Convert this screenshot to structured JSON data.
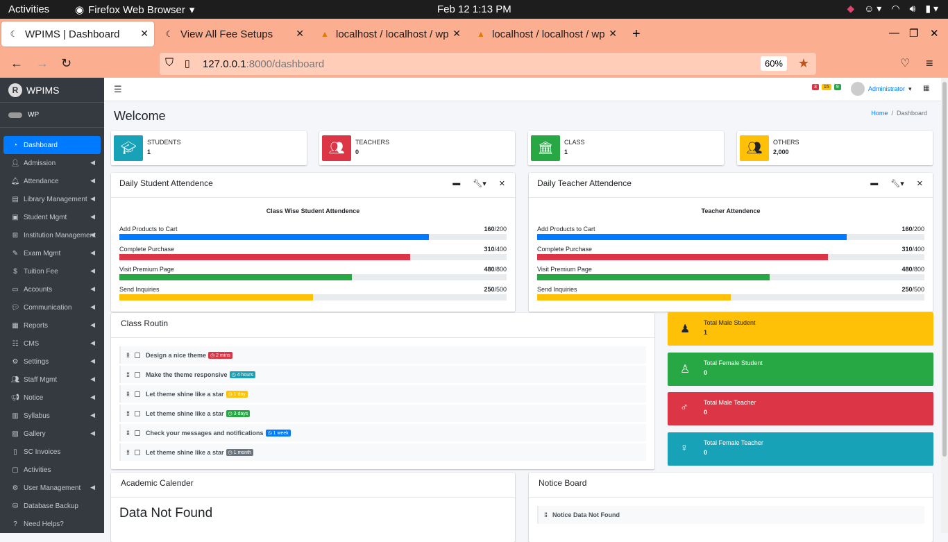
{
  "system": {
    "activities": "Activities",
    "app_name": "Firefox Web Browser",
    "clock": "Feb 12  1:13 PM"
  },
  "browser": {
    "tabs": [
      {
        "title": "WPIMS | Dashboard",
        "active": true
      },
      {
        "title": "View All Fee Setups",
        "active": false
      },
      {
        "title": "localhost / localhost / wp",
        "active": false
      },
      {
        "title": "localhost / localhost / wp",
        "active": false
      }
    ],
    "url_host": "127.0.0.1",
    "url_path": ":8000/dashboard",
    "zoom": "60%"
  },
  "sidebar": {
    "brand": "WPIMS",
    "user": "WP",
    "items": [
      {
        "label": "Dashboard",
        "icon": "dashboard-icon",
        "active": true,
        "caret": false
      },
      {
        "label": "Admission",
        "icon": "user-plus-icon",
        "caret": true
      },
      {
        "label": "Attendance",
        "icon": "bell-icon",
        "caret": true
      },
      {
        "label": "Library Management",
        "icon": "book-icon",
        "caret": true
      },
      {
        "label": "Student Mgmt",
        "icon": "id-card-icon",
        "caret": true
      },
      {
        "label": "Institution Management",
        "icon": "table-icon",
        "caret": true
      },
      {
        "label": "Exam Mgmt",
        "icon": "exam-icon",
        "caret": true
      },
      {
        "label": "Tuition Fee",
        "icon": "money-icon",
        "caret": true
      },
      {
        "label": "Accounts",
        "icon": "wallet-icon",
        "caret": true
      },
      {
        "label": "Communication",
        "icon": "comments-icon",
        "caret": true
      },
      {
        "label": "Reports",
        "icon": "report-icon",
        "caret": true
      },
      {
        "label": "CMS",
        "icon": "list-icon",
        "caret": true
      },
      {
        "label": "Settings",
        "icon": "gears-icon",
        "caret": true
      },
      {
        "label": "Staff Mgmt",
        "icon": "users-icon",
        "caret": true
      },
      {
        "label": "Notice",
        "icon": "bullhorn-icon",
        "caret": true
      },
      {
        "label": "Syllabus",
        "icon": "syllabus-icon",
        "caret": true
      },
      {
        "label": "Gallery",
        "icon": "image-icon",
        "caret": true
      },
      {
        "label": "SC Invoices",
        "icon": "invoice-icon",
        "caret": false
      },
      {
        "label": "Activities",
        "icon": "activity-icon",
        "caret": false
      },
      {
        "label": "User Management",
        "icon": "users-cog-icon",
        "caret": true
      },
      {
        "label": "Database Backup",
        "icon": "database-icon",
        "caret": false
      },
      {
        "label": "Need Helps?",
        "icon": "help-icon",
        "caret": false
      }
    ]
  },
  "header": {
    "badges": [
      "3",
      "15",
      "9"
    ],
    "user": "Administrator"
  },
  "page": {
    "title": "Welcome",
    "breadcrumb_home": "Home",
    "breadcrumb_current": "Dashboard"
  },
  "info_boxes": [
    {
      "label": "STUDENTS",
      "value": "1",
      "color": "#17a2b8"
    },
    {
      "label": "TEACHERS",
      "value": "0",
      "color": "#dc3545"
    },
    {
      "label": "CLASS",
      "value": "1",
      "color": "#28a745"
    },
    {
      "label": "OTHERS",
      "value": "2,000",
      "color": "#ffc107"
    }
  ],
  "student_attendance": {
    "title": "Daily Student Attendence",
    "subtitle": "Class Wise Student Attendence",
    "rows": [
      {
        "label": "Add Products to Cart",
        "value": "160",
        "total": "/200",
        "fraction": 0.8,
        "color": "#007bff"
      },
      {
        "label": "Complete Purchase",
        "value": "310",
        "total": "/400",
        "fraction": 0.75,
        "color": "#dc3545"
      },
      {
        "label": "Visit Premium Page",
        "value": "480",
        "total": "/800",
        "fraction": 0.6,
        "color": "#28a745"
      },
      {
        "label": "Send Inquiries",
        "value": "250",
        "total": "/500",
        "fraction": 0.5,
        "color": "#ffc107"
      }
    ]
  },
  "teacher_attendance": {
    "title": "Daily Teacher Attendence",
    "subtitle": "Teacher Attendence",
    "rows": [
      {
        "label": "Add Products to Cart",
        "value": "160",
        "total": "/200",
        "fraction": 0.8,
        "color": "#007bff"
      },
      {
        "label": "Complete Purchase",
        "value": "310",
        "total": "/400",
        "fraction": 0.75,
        "color": "#dc3545"
      },
      {
        "label": "Visit Premium Page",
        "value": "480",
        "total": "/800",
        "fraction": 0.6,
        "color": "#28a745"
      },
      {
        "label": "Send Inquiries",
        "value": "250",
        "total": "/500",
        "fraction": 0.5,
        "color": "#ffc107"
      }
    ]
  },
  "class_routine": {
    "title": "Class Routin",
    "items": [
      {
        "text": "Design a nice theme",
        "badge": "2 mins",
        "color": "#dc3545"
      },
      {
        "text": "Make the theme responsive",
        "badge": "4 hours",
        "color": "#17a2b8"
      },
      {
        "text": "Let theme shine like a star",
        "badge": "1 day",
        "color": "#ffc107"
      },
      {
        "text": "Let theme shine like a star",
        "badge": "3 days",
        "color": "#28a745"
      },
      {
        "text": "Check your messages and notifications",
        "badge": "1 week",
        "color": "#007bff"
      },
      {
        "text": "Let theme shine like a star",
        "badge": "1 month",
        "color": "#6c757d"
      }
    ]
  },
  "stat_boxes": [
    {
      "label": "Total Male Student",
      "value": "1",
      "color": "#ffc107",
      "icon": "male-icon"
    },
    {
      "label": "Total Female Student",
      "value": "0",
      "color": "#28a745",
      "icon": "female-icon"
    },
    {
      "label": "Total Male Teacher",
      "value": "0",
      "color": "#dc3545",
      "icon": "mars-icon"
    },
    {
      "label": "Total Female Teacher",
      "value": "0",
      "color": "#17a2b8",
      "icon": "venus-icon"
    }
  ],
  "academic_calendar": {
    "title": "Academic Calender",
    "message": "Data Not Found"
  },
  "notice_board": {
    "title": "Notice Board",
    "message": "Notice Data Not Found"
  }
}
